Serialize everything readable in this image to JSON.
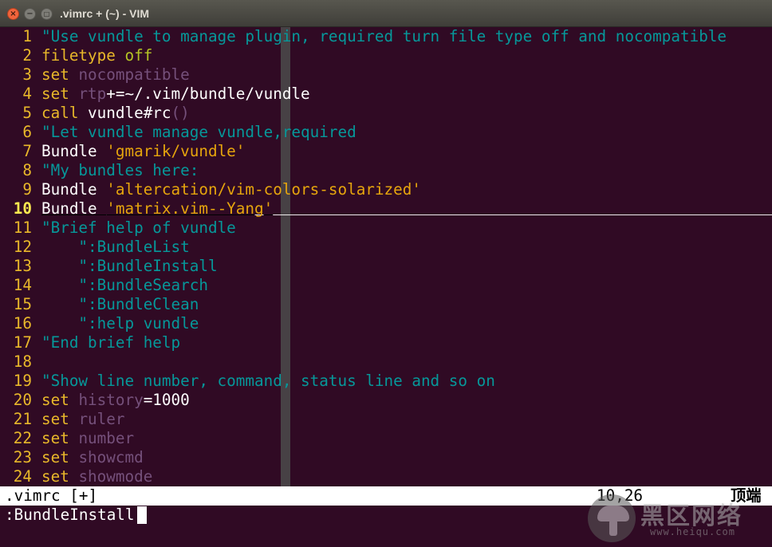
{
  "window": {
    "title": ".vimrc + (~) - VIM",
    "close_glyph": "×",
    "minimize_glyph": "−",
    "maximize_glyph": "□"
  },
  "editor": {
    "lines": [
      {
        "n": "1",
        "parts": [
          {
            "t": "\"Use vundle to manage plugin, required turn file type off and nocompatible",
            "c": "comment"
          }
        ]
      },
      {
        "n": "2",
        "parts": [
          {
            "t": "filetype",
            "c": "kw"
          },
          {
            "t": " ",
            "c": "norm"
          },
          {
            "t": "off",
            "c": "off"
          }
        ]
      },
      {
        "n": "3",
        "parts": [
          {
            "t": "set",
            "c": "kw"
          },
          {
            "t": " ",
            "c": "norm"
          },
          {
            "t": "nocompatible",
            "c": "opt"
          }
        ]
      },
      {
        "n": "4",
        "parts": [
          {
            "t": "set",
            "c": "kw"
          },
          {
            "t": " ",
            "c": "norm"
          },
          {
            "t": "rtp",
            "c": "opt"
          },
          {
            "t": "+=~/.vim/bundle/vundle",
            "c": "norm"
          }
        ]
      },
      {
        "n": "5",
        "parts": [
          {
            "t": "call",
            "c": "kw"
          },
          {
            "t": " vundle#rc",
            "c": "norm"
          },
          {
            "t": "()",
            "c": "paren"
          }
        ]
      },
      {
        "n": "6",
        "parts": [
          {
            "t": "\"Let vundle manage vundle,required",
            "c": "comment"
          }
        ]
      },
      {
        "n": "7",
        "parts": [
          {
            "t": "Bundle ",
            "c": "norm"
          },
          {
            "t": "'gmarik/vundle'",
            "c": "str"
          }
        ]
      },
      {
        "n": "8",
        "parts": [
          {
            "t": "\"My bundles here:",
            "c": "comment"
          }
        ]
      },
      {
        "n": "9",
        "parts": [
          {
            "t": "Bundle ",
            "c": "norm"
          },
          {
            "t": "'altercation/vim-colors-solarized'",
            "c": "str"
          }
        ]
      },
      {
        "n": "10",
        "current": true,
        "parts": [
          {
            "t": "Bundle ",
            "c": "norm"
          },
          {
            "t": "'matrix.vim--Yang'",
            "c": "str"
          }
        ]
      },
      {
        "n": "11",
        "parts": [
          {
            "t": "\"Brief help of vundle",
            "c": "comment"
          }
        ]
      },
      {
        "n": "12",
        "parts": [
          {
            "t": "    \":BundleList",
            "c": "comment"
          }
        ]
      },
      {
        "n": "13",
        "parts": [
          {
            "t": "    \":BundleInstall",
            "c": "comment"
          }
        ]
      },
      {
        "n": "14",
        "parts": [
          {
            "t": "    \":BundleSearch",
            "c": "comment"
          }
        ]
      },
      {
        "n": "15",
        "parts": [
          {
            "t": "    \":BundleClean",
            "c": "comment"
          }
        ]
      },
      {
        "n": "16",
        "parts": [
          {
            "t": "    \":help vundle",
            "c": "comment"
          }
        ]
      },
      {
        "n": "17",
        "parts": [
          {
            "t": "\"End brief help",
            "c": "comment"
          }
        ]
      },
      {
        "n": "18",
        "parts": []
      },
      {
        "n": "19",
        "parts": [
          {
            "t": "\"Show line number, command, status line and so on",
            "c": "comment"
          }
        ]
      },
      {
        "n": "20",
        "parts": [
          {
            "t": "set",
            "c": "kw"
          },
          {
            "t": " ",
            "c": "norm"
          },
          {
            "t": "history",
            "c": "opt"
          },
          {
            "t": "=1000",
            "c": "norm"
          }
        ]
      },
      {
        "n": "21",
        "parts": [
          {
            "t": "set",
            "c": "kw"
          },
          {
            "t": " ",
            "c": "norm"
          },
          {
            "t": "ruler",
            "c": "opt"
          }
        ]
      },
      {
        "n": "22",
        "parts": [
          {
            "t": "set",
            "c": "kw"
          },
          {
            "t": " ",
            "c": "norm"
          },
          {
            "t": "number",
            "c": "opt"
          }
        ]
      },
      {
        "n": "23",
        "parts": [
          {
            "t": "set",
            "c": "kw"
          },
          {
            "t": " ",
            "c": "norm"
          },
          {
            "t": "showcmd",
            "c": "opt"
          }
        ]
      },
      {
        "n": "24",
        "parts": [
          {
            "t": "set",
            "c": "kw"
          },
          {
            "t": " ",
            "c": "norm"
          },
          {
            "t": "showmode",
            "c": "opt"
          }
        ]
      }
    ]
  },
  "statusline": {
    "filename": ".vimrc [+]",
    "position": "10,26",
    "scroll": "顶端"
  },
  "cmdline": {
    "text": ":BundleInstall"
  },
  "watermark": {
    "name": "黑区网络",
    "url": "www.heiqu.com"
  },
  "colors": {
    "background": "#300a24",
    "line_number": "#e9b82a",
    "comment": "#06989a",
    "keyword": "#e9b82a",
    "option": "#75507b",
    "string": "#e6a50d",
    "text": "#ffffff"
  }
}
